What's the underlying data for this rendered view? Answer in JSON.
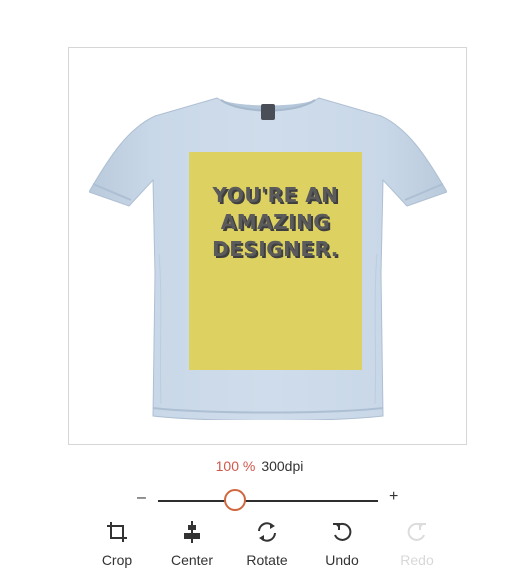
{
  "design": {
    "text_lines": [
      "YOU'RE AN",
      "AMAZING",
      "DESIGNER."
    ],
    "print_color": "#ddd161",
    "shirt_color": "#c7d6e6",
    "text_color": "#5b5b5b"
  },
  "zoom": {
    "percent": "100 %",
    "dpi": "300dpi",
    "percent_color": "#d0574b",
    "slider_level": 0.35
  },
  "slider": {
    "minus_label": "–",
    "plus_label": "+",
    "accent_color": "#d0683f"
  },
  "toolbar": {
    "items": [
      {
        "label": "Crop",
        "icon": "crop-icon",
        "enabled": true
      },
      {
        "label": "Center",
        "icon": "center-align-icon",
        "enabled": true
      },
      {
        "label": "Rotate",
        "icon": "rotate-icon",
        "enabled": true
      },
      {
        "label": "Undo",
        "icon": "undo-icon",
        "enabled": true
      },
      {
        "label": "Redo",
        "icon": "redo-icon",
        "enabled": false
      }
    ]
  }
}
